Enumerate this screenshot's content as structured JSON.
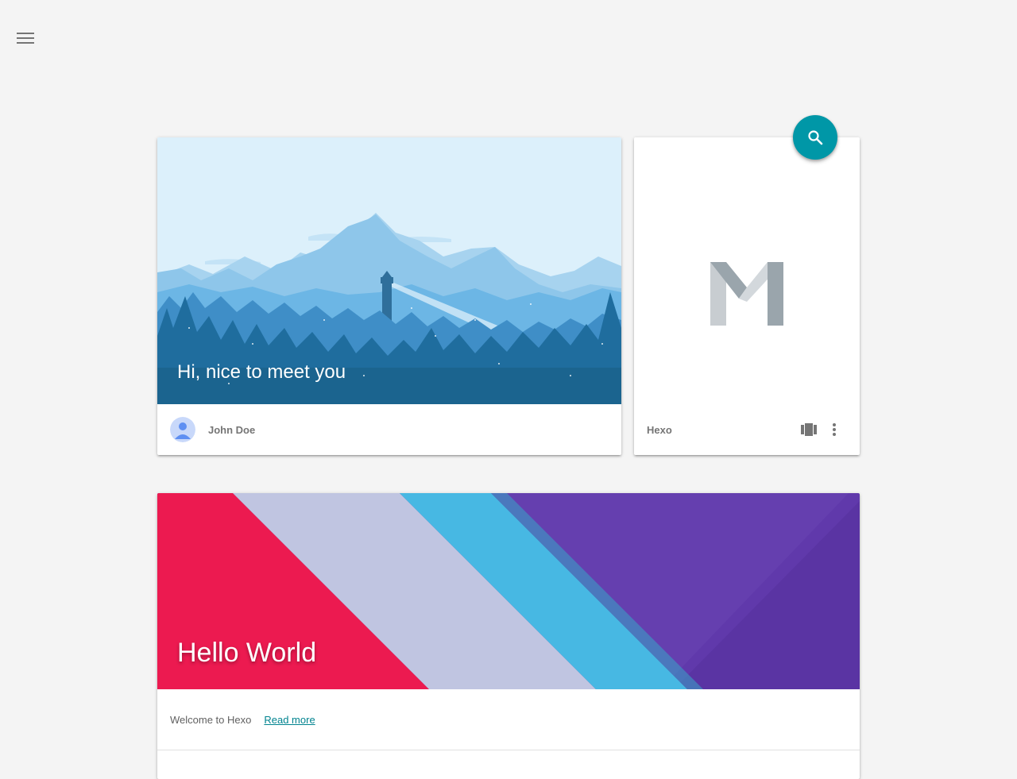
{
  "nav": {
    "menu_icon": "hamburger-menu-icon"
  },
  "search": {
    "icon": "search-icon",
    "color": "#0097a7"
  },
  "welcome_card": {
    "title": "Hi, nice to meet you",
    "author": "John Doe",
    "avatar_icon": "user-avatar-icon"
  },
  "blog_card": {
    "name": "Hexo",
    "logo_icon": "material-m-logo-icon",
    "actions": [
      {
        "icon": "view-carousel-icon"
      },
      {
        "icon": "more-vert-icon"
      }
    ]
  },
  "post": {
    "title": "Hello World",
    "excerpt": "Welcome to Hexo",
    "read_more": "Read more"
  },
  "colors": {
    "background": "#f4f4f4",
    "accent": "#0097a7",
    "link": "#00838f",
    "post_red": "#ec1a50",
    "post_lavender": "#c0c5e1",
    "post_cyan": "#47b8e3",
    "post_purple": "#6039ab"
  }
}
